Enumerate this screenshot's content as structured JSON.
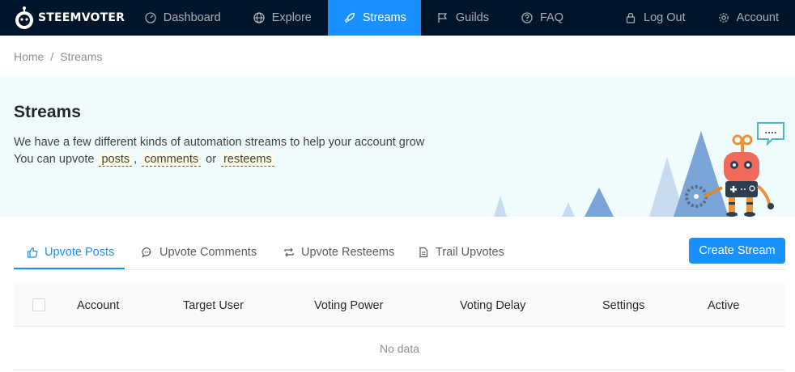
{
  "brand": {
    "name": "STEEMVOTER"
  },
  "nav": {
    "items": [
      {
        "label": "Dashboard",
        "icon": "dashboard-icon"
      },
      {
        "label": "Explore",
        "icon": "globe-icon"
      },
      {
        "label": "Streams",
        "icon": "rocket-icon",
        "active": true
      },
      {
        "label": "Guilds",
        "icon": "flag-icon"
      },
      {
        "label": "FAQ",
        "icon": "question-circle-icon"
      },
      {
        "label": "Log Out",
        "icon": "lock-icon"
      },
      {
        "label": "Account",
        "icon": "gear-icon"
      }
    ]
  },
  "breadcrumb": {
    "home": "Home",
    "separator": "/",
    "current": "Streams"
  },
  "hero": {
    "title": "Streams",
    "line1": "We have a few different kinds of automation streams to help your account grow",
    "line2_prefix": "You can upvote",
    "tags": [
      "posts",
      "comments",
      "resteems"
    ],
    "comma": ",",
    "or": "or",
    "speech": "...."
  },
  "tabs": [
    {
      "label": "Upvote Posts",
      "icon": "like-icon",
      "active": true
    },
    {
      "label": "Upvote Comments",
      "icon": "message-icon"
    },
    {
      "label": "Upvote Resteems",
      "icon": "retweet-icon"
    },
    {
      "label": "Trail Upvotes",
      "icon": "file-icon"
    }
  ],
  "create_button": "Create Stream",
  "table": {
    "columns": [
      "Account",
      "Target User",
      "Voting Power",
      "Voting Delay",
      "Settings",
      "Active"
    ],
    "empty_text": "No data"
  },
  "colors": {
    "primary": "#1890ff",
    "header_bg": "#001529",
    "hero_bg": "#f0fbfd"
  }
}
